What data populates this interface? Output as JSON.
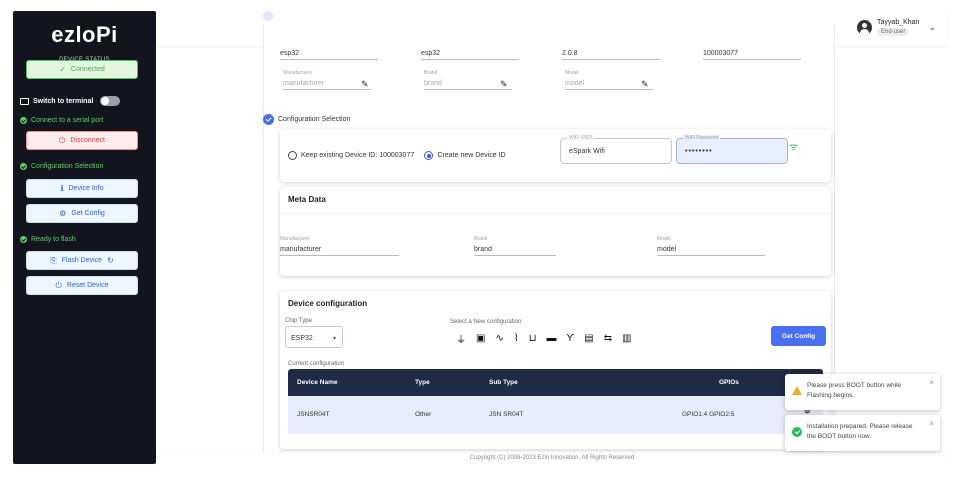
{
  "sidebar": {
    "logo": "ezloPi",
    "device_status_label": "DEVICE STATUS",
    "connected_label": "Connected",
    "switch_terminal_label": "Switch to terminal",
    "connect_serial_label": "Connect to a serial port",
    "disconnect_label": "Disconnect",
    "config_selection_label": "Configuration Selection",
    "device_info_label": "Device Info",
    "get_config_label": "Get Config",
    "ready_flash_label": "Ready to flash",
    "flash_device_label": "Flash Device",
    "reset_device_label": "Reset Device"
  },
  "header": {
    "username": "Tayyab_Khan",
    "role": "End-user"
  },
  "device_row": {
    "v1": "esp32",
    "v2": "esp32",
    "v3": "2.0.8",
    "v4": "100003077"
  },
  "editable_row": {
    "manufacturer_label": "Manufacturer",
    "manufacturer_placeholder": "manufacturer",
    "brand_label": "Brand",
    "brand_placeholder": "brand",
    "model_label": "Model",
    "model_placeholder": "model"
  },
  "configuration_selection": {
    "title": "Configuration Selection",
    "keep_existing_label": "Keep existing Device ID: 100003077",
    "create_new_label": "Create new Device ID",
    "wifi_ssid_label": "WiFi SSID",
    "wifi_ssid_value": "eSpark Wifi",
    "wifi_password_label": "WiFi Password",
    "wifi_password_value": "••••••••"
  },
  "meta_data": {
    "title": "Meta Data",
    "manufacturer_label": "Manufacturer",
    "manufacturer_value": "manufacturer",
    "brand_label": "Brand",
    "brand_value": "brand",
    "model_label": "Model",
    "model_value": "model"
  },
  "device_configuration": {
    "title": "Device configuration",
    "chip_type_label": "Chip Type",
    "chip_type_value": "ESP32",
    "select_new_label": "Select a New configuration",
    "get_config_button": "Get Config",
    "current_config_label": "Current configuration",
    "columns": [
      "Device Name",
      "Type",
      "Sub Type",
      "GPIOs"
    ],
    "rows": [
      [
        "JSNSR04T",
        "Other",
        "JSN SR04T",
        "GPIO1:4 GPIO2:5"
      ]
    ]
  },
  "footer": {
    "copyright": "Copyright (C) 2008-2023 Ezlo Innovation. All Rights Reserved"
  },
  "toasts": [
    {
      "text": "Please press BOOT button while Flashing begins.",
      "type": "warning"
    },
    {
      "text": "Installation prepared. Please release the BOOT button now.",
      "type": "success"
    }
  ],
  "colors": {
    "sidebar_bg": "#12151d",
    "accent_blue": "#4a6ff0",
    "success_green": "#5fd067",
    "danger_red": "#d33a3a",
    "table_header": "#1f2a44"
  }
}
